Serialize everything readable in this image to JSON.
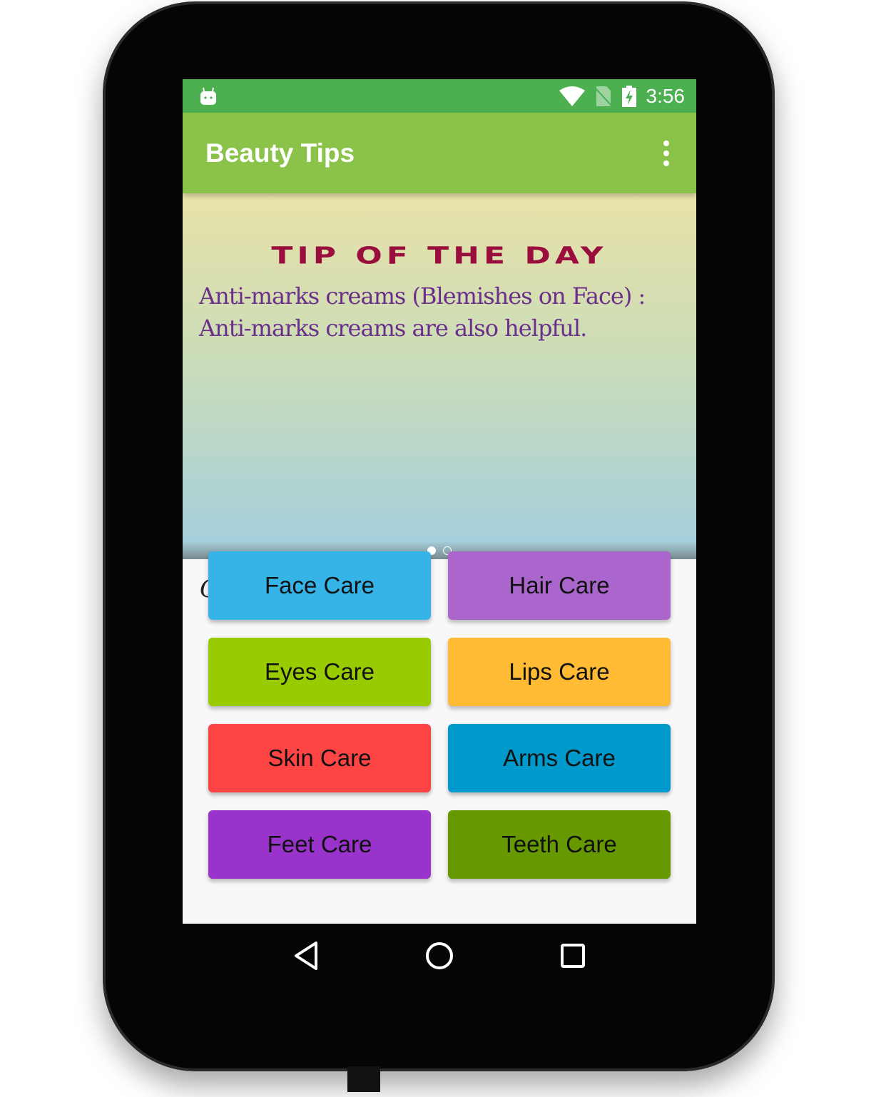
{
  "status": {
    "time": "3:56"
  },
  "appbar": {
    "title": "Beauty Tips"
  },
  "banner": {
    "heading": "TIP OF THE DAY",
    "text": "Anti-marks creams (Blemishes on Face) : Anti-marks creams are also helpful.",
    "pages": 2,
    "current_page": 1
  },
  "categories": {
    "title": "Categories",
    "items": [
      {
        "label": "Face Care",
        "color": "#36b4e8"
      },
      {
        "label": "Hair Care",
        "color": "#aa66cc"
      },
      {
        "label": "Eyes Care",
        "color": "#99cc00"
      },
      {
        "label": "Lips Care",
        "color": "#ffbb33"
      },
      {
        "label": "Skin Care",
        "color": "#ff4444"
      },
      {
        "label": "Arms Care",
        "color": "#0099cc"
      },
      {
        "label": "Feet Care",
        "color": "#9933cc"
      },
      {
        "label": "Teeth Care",
        "color": "#669900"
      }
    ]
  }
}
